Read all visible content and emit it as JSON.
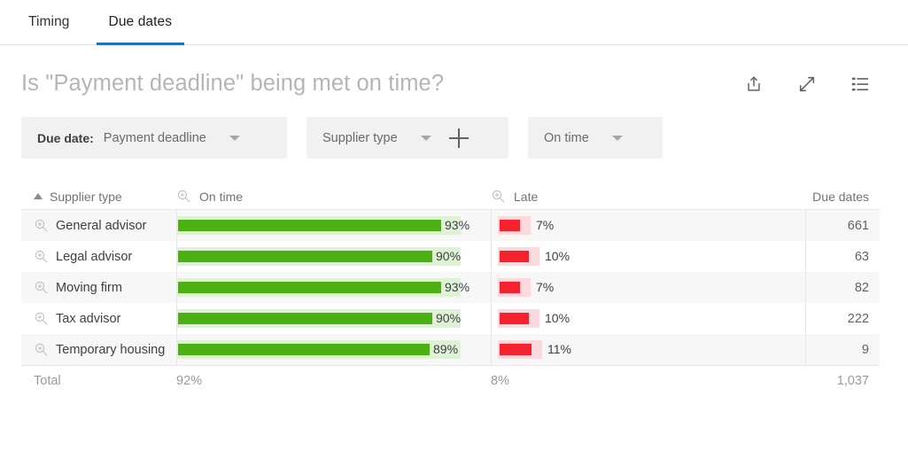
{
  "tabs": [
    {
      "label": "Timing",
      "active": false
    },
    {
      "label": "Due dates",
      "active": true
    }
  ],
  "header": {
    "title": "Is \"Payment deadline\" being met on time?",
    "icons": [
      {
        "name": "share-icon",
        "glyph": "share"
      },
      {
        "name": "expand-icon",
        "glyph": "expand"
      },
      {
        "name": "list-view-icon",
        "glyph": "list"
      }
    ]
  },
  "filters": [
    {
      "label": "Due date:",
      "value": "Payment deadline",
      "has_caret": true,
      "has_plus": false
    },
    {
      "label": "",
      "value": "Supplier type",
      "has_caret": true,
      "has_plus": true
    },
    {
      "label": "",
      "value": "On time",
      "has_caret": true,
      "has_plus": false
    }
  ],
  "table": {
    "columns": {
      "supplier": "Supplier type",
      "ontime": "On time",
      "late": "Late",
      "due": "Due dates"
    },
    "sort": {
      "column": "supplier",
      "direction": "asc"
    },
    "rows": [
      {
        "supplier": "General advisor",
        "ontime_pct": 93,
        "ontime_label": "93%",
        "late_pct": 7,
        "late_label": "7%",
        "due": "661"
      },
      {
        "supplier": "Legal advisor",
        "ontime_pct": 90,
        "ontime_label": "90%",
        "late_pct": 10,
        "late_label": "10%",
        "due": "63"
      },
      {
        "supplier": "Moving firm",
        "ontime_pct": 93,
        "ontime_label": "93%",
        "late_pct": 7,
        "late_label": "7%",
        "due": "82"
      },
      {
        "supplier": "Tax advisor",
        "ontime_pct": 90,
        "ontime_label": "90%",
        "late_pct": 10,
        "late_label": "10%",
        "due": "222"
      },
      {
        "supplier": "Temporary housing",
        "ontime_pct": 89,
        "ontime_label": "89%",
        "late_pct": 11,
        "late_label": "11%",
        "due": "9"
      }
    ],
    "total": {
      "label": "Total",
      "ontime": "92%",
      "late": "8%",
      "due": "1,037"
    }
  },
  "chart_data": {
    "type": "bar",
    "title": "Is \"Payment deadline\" being met on time?",
    "categories": [
      "General advisor",
      "Legal advisor",
      "Moving firm",
      "Tax advisor",
      "Temporary housing"
    ],
    "series": [
      {
        "name": "On time",
        "values": [
          93,
          90,
          93,
          90,
          89
        ],
        "unit": "%",
        "color": "#4caf12"
      },
      {
        "name": "Late",
        "values": [
          7,
          10,
          7,
          10,
          11
        ],
        "unit": "%",
        "color": "#f4212e"
      },
      {
        "name": "Due dates",
        "values": [
          661,
          63,
          82,
          222,
          9
        ],
        "unit": "count",
        "color": "#5f6368"
      }
    ],
    "totals": {
      "On time": "92%",
      "Late": "8%",
      "Due dates": "1,037"
    },
    "xlabel": "Supplier type",
    "ylabel": "",
    "ylim": [
      0,
      100
    ],
    "grid": false,
    "legend": "none"
  },
  "colors": {
    "accent": "#1a73c8",
    "green_fill": "#4caf12",
    "green_track": "#e0f2d6",
    "red_fill": "#f4212e",
    "red_track": "#fcd9dd",
    "row_stripe": "#f7f7f7"
  }
}
